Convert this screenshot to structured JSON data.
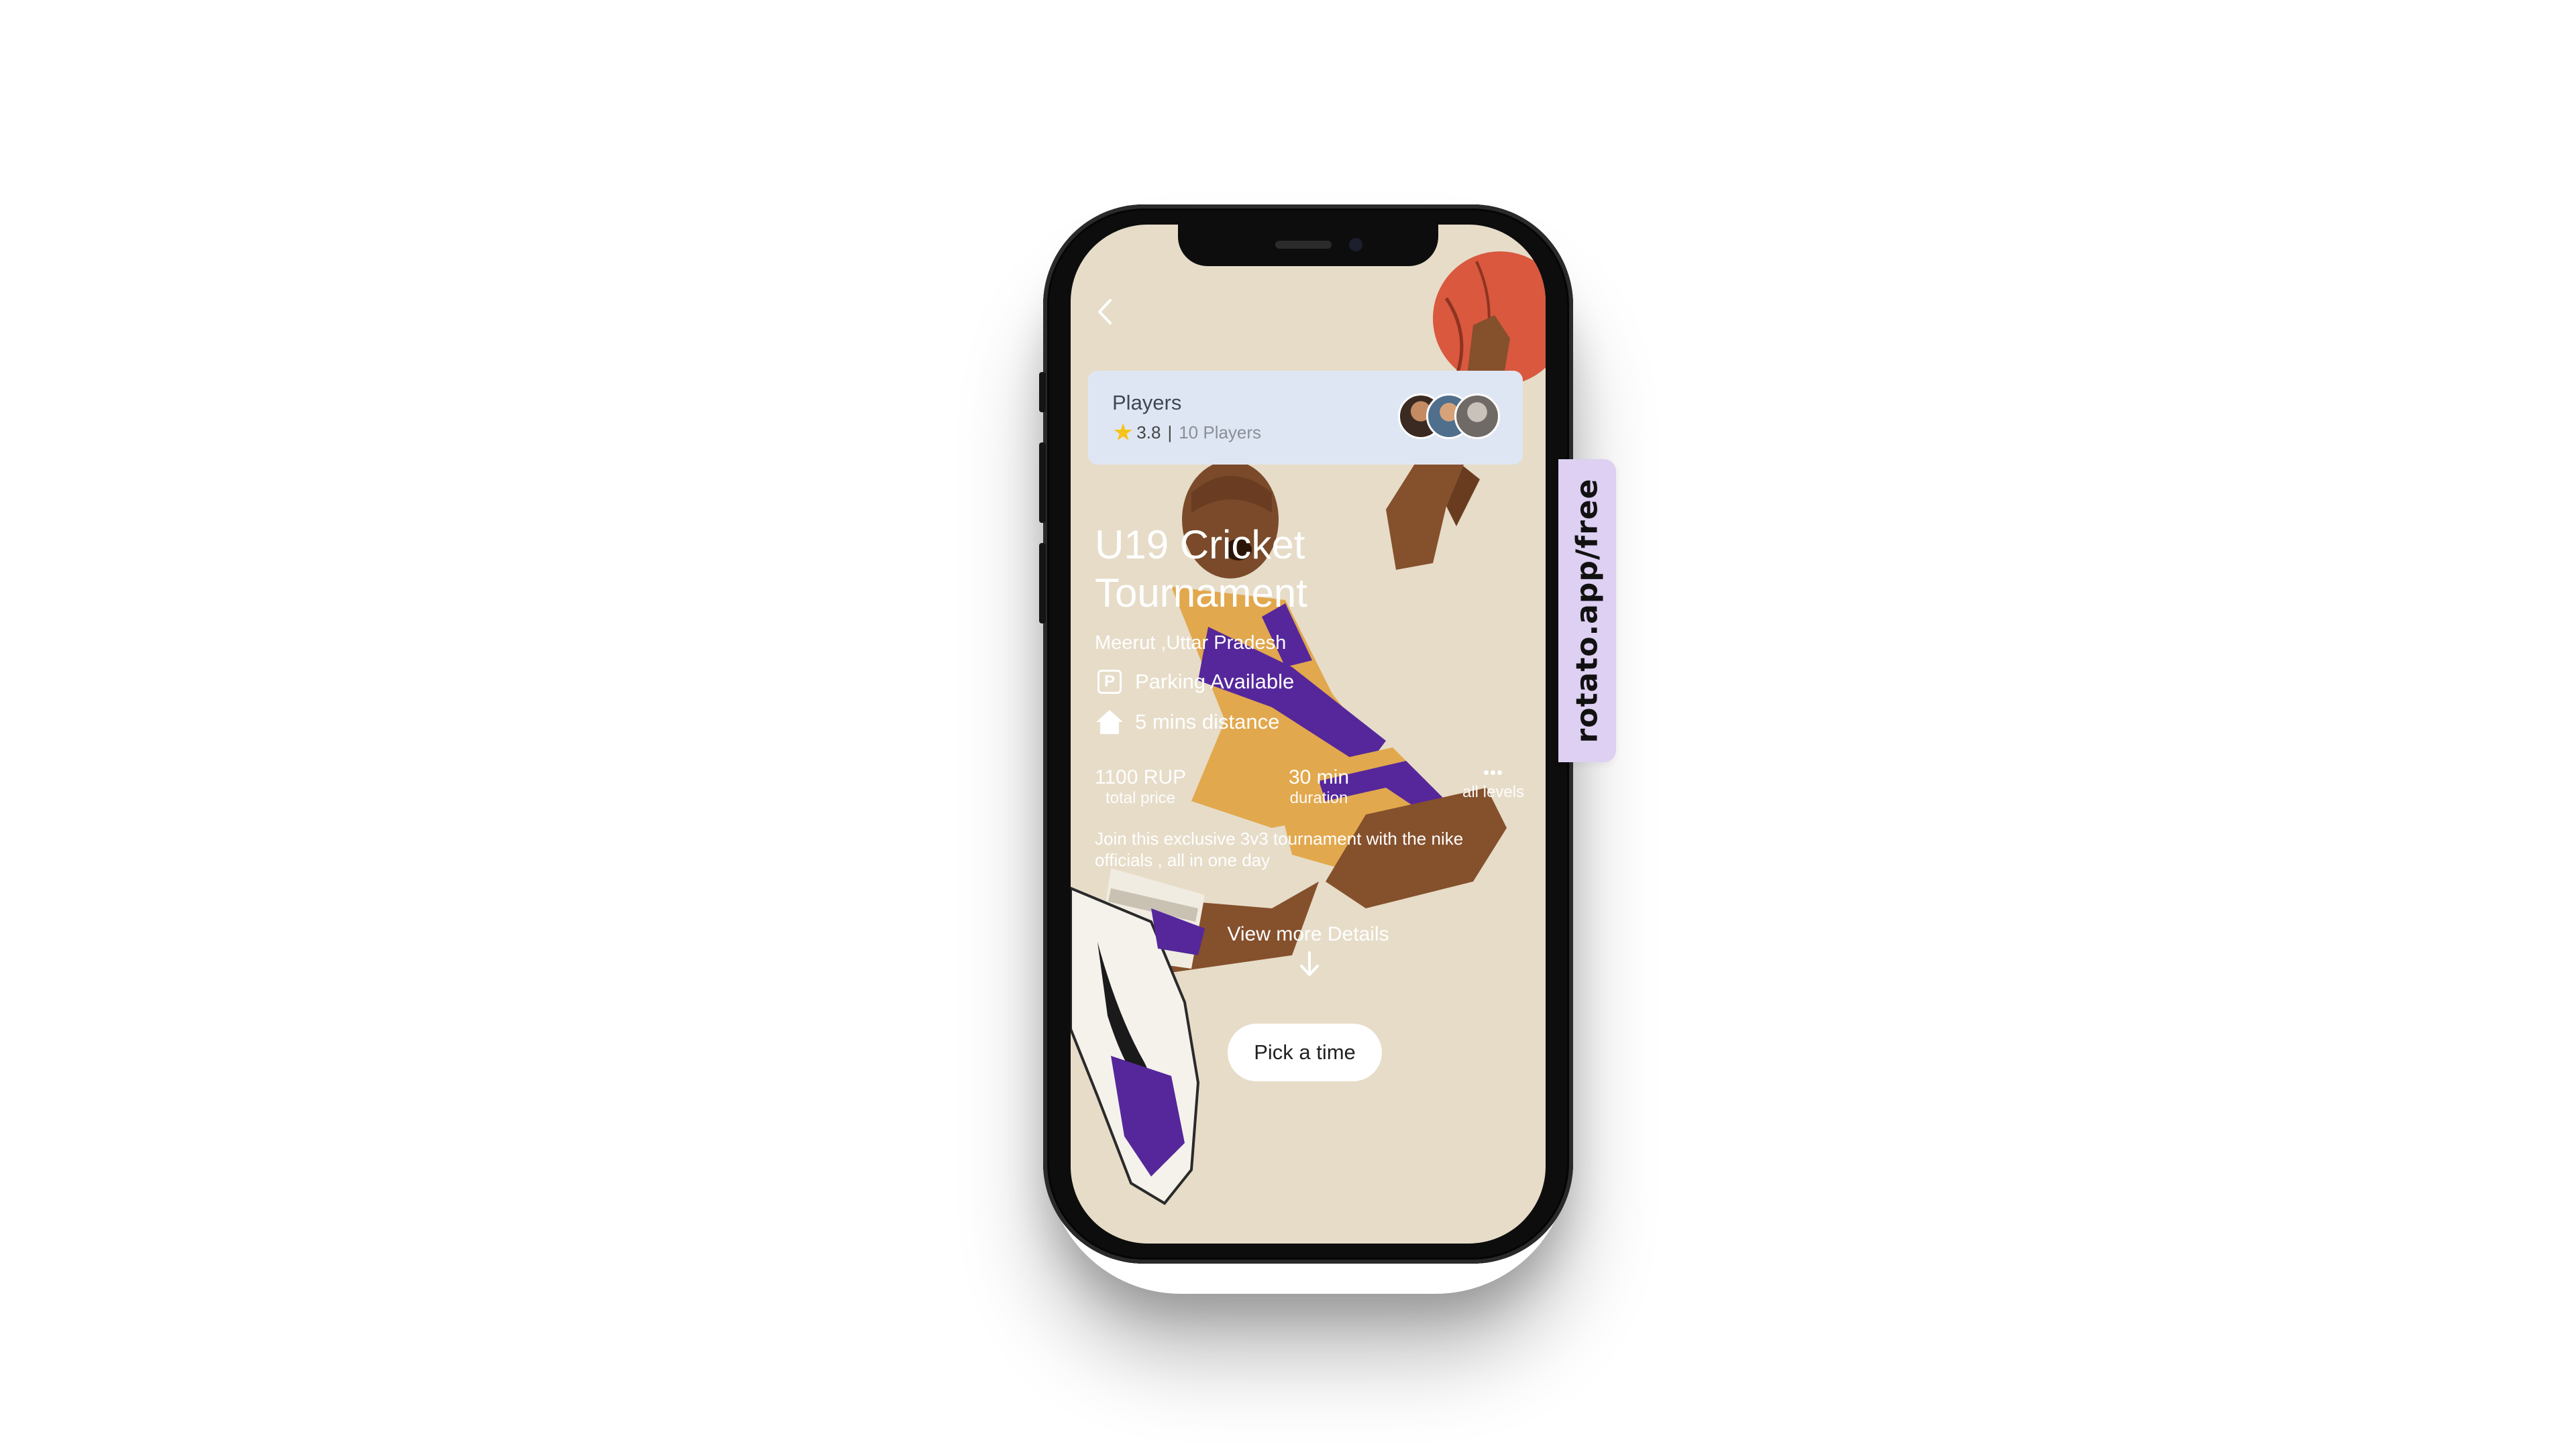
{
  "screen": {
    "back_icon": "chevron-left-icon",
    "players_card": {
      "title": "Players",
      "rating": "3.8",
      "separator": "|",
      "players_count": "10 Players",
      "star_icon": "star-icon",
      "avatar_count": 3
    },
    "event": {
      "title": "U19 Cricket Tournament",
      "location": "Meerut ,Uttar Pradesh",
      "features": [
        {
          "icon": "parking-icon",
          "label": "Parking Available"
        },
        {
          "icon": "home-icon",
          "label": "5 mins distance"
        }
      ],
      "stats": [
        {
          "value": "1100 RUP",
          "caption": "total price"
        },
        {
          "value": "30 min",
          "caption": "duration"
        },
        {
          "value": "•••",
          "caption": "all levels"
        }
      ],
      "description": "Join this exclusive 3v3 tournament with the nike officials , all in one day",
      "more_label": "View more Details",
      "cta": "Pick a time"
    },
    "colors": {
      "background": "#e6dcc8",
      "card": "#dfe6f3",
      "accent_purple": "#55279b",
      "accent_gold": "#e2a84d",
      "ball": "#d9583e"
    }
  },
  "watermark": "rotato.app/free"
}
